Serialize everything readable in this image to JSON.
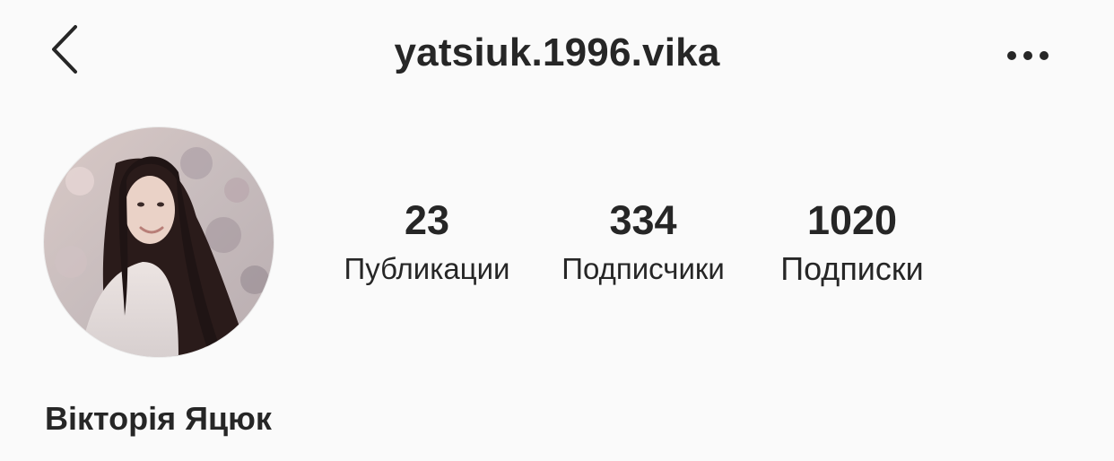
{
  "header": {
    "username": "yatsiuk.1996.vika",
    "back_icon": "chevron-left-icon",
    "more_icon": "more-horizontal-icon"
  },
  "profile": {
    "avatar_description": "profile photo",
    "full_name": "Вікторія Яцюк"
  },
  "stats": {
    "posts": {
      "count": "23",
      "label": "Публикации"
    },
    "followers": {
      "count": "334",
      "label": "Подписчики"
    },
    "following": {
      "count": "1020",
      "label": "Подписки"
    }
  },
  "colors": {
    "background": "#fafafa",
    "text": "#262626"
  }
}
